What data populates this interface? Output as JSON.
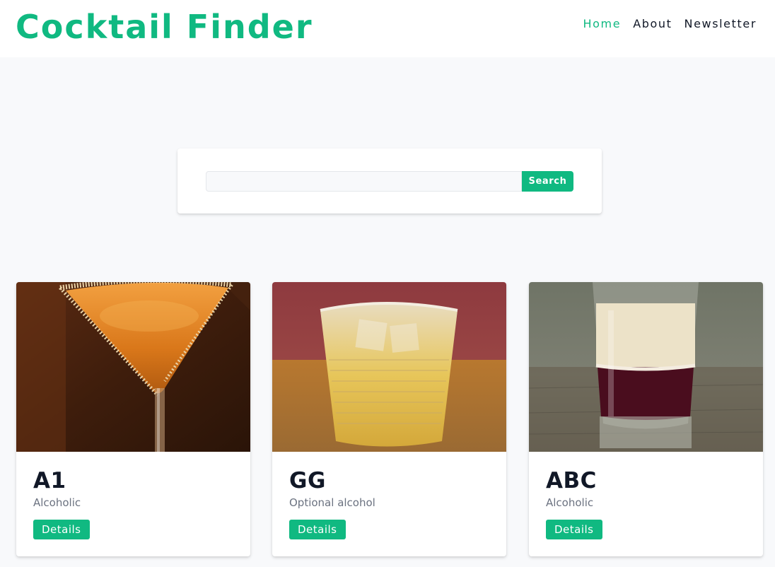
{
  "brand": {
    "title": "Cocktail Finder",
    "accent_color": "#10b981"
  },
  "nav": {
    "items": [
      {
        "label": "Home",
        "active": true
      },
      {
        "label": "About",
        "active": false
      },
      {
        "label": "Newsletter",
        "active": false
      }
    ]
  },
  "search": {
    "value": "",
    "placeholder": "",
    "button_label": "Search"
  },
  "cocktails": [
    {
      "name": "A1",
      "info": "Alcoholic",
      "details_label": "Details",
      "image": "orange-martini-photo"
    },
    {
      "name": "GG",
      "info": "Optional alcohol",
      "details_label": "Details",
      "image": "rocks-glass-yellow-drink-photo"
    },
    {
      "name": "ABC",
      "info": "Alcoholic",
      "details_label": "Details",
      "image": "layered-shot-photo"
    }
  ]
}
